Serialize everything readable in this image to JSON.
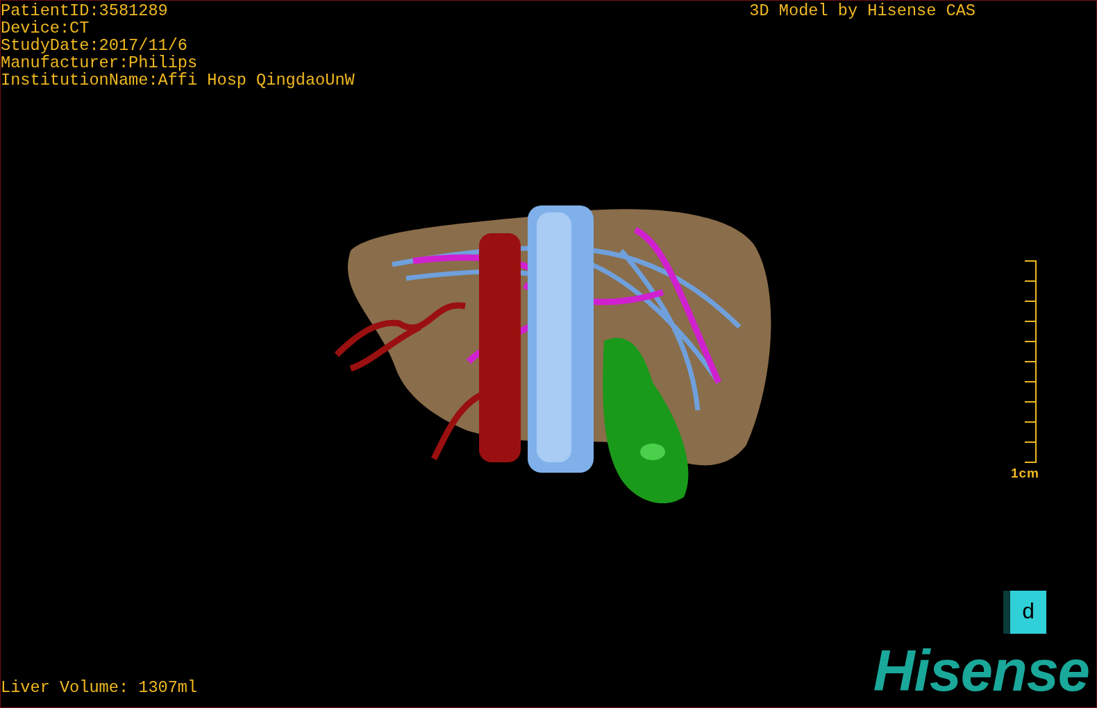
{
  "patient_info": [
    "PatientID:3581289",
    "Device:CT",
    "StudyDate:2017/11/6",
    "Manufacturer:Philips",
    "InstitutionName:Affi Hosp QingdaoUnW"
  ],
  "title": "3D Model by Hisense CAS",
  "scale_bar": {
    "label": "1cm"
  },
  "orientation_cube": {
    "label": "d"
  },
  "liver_volume": "Liver Volume: 1307ml",
  "logo": "Hisense"
}
